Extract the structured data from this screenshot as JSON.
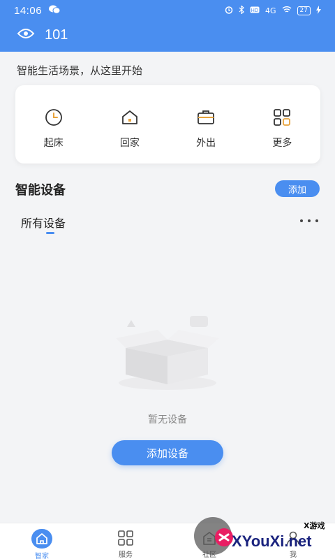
{
  "status_bar": {
    "time": "14:06",
    "battery": "27",
    "network": "4G"
  },
  "header": {
    "title": "101"
  },
  "scenes": {
    "tagline": "智能生活场景，从这里开始",
    "items": [
      {
        "label": "起床",
        "icon": "clock-icon"
      },
      {
        "label": "回家",
        "icon": "home-icon"
      },
      {
        "label": "外出",
        "icon": "briefcase-icon"
      },
      {
        "label": "更多",
        "icon": "grid-icon"
      }
    ]
  },
  "devices": {
    "section_title": "智能设备",
    "add_label": "添加",
    "tab_all": "所有设备",
    "empty_text": "暂无设备",
    "add_device_label": "添加设备"
  },
  "bottom_nav": {
    "items": [
      {
        "label": "智家",
        "icon": "home-icon",
        "active": true
      },
      {
        "label": "服务",
        "icon": "grid-icon",
        "active": false
      },
      {
        "label": "社区",
        "icon": "community-icon",
        "active": false
      },
      {
        "label": "我",
        "icon": "profile-icon",
        "active": false
      }
    ]
  },
  "watermark": {
    "brand": "XYouXi.net",
    "tag": "X游戏"
  },
  "colors": {
    "accent": "#4a8ef0",
    "background": "#f3f4f6",
    "card": "#ffffff"
  }
}
